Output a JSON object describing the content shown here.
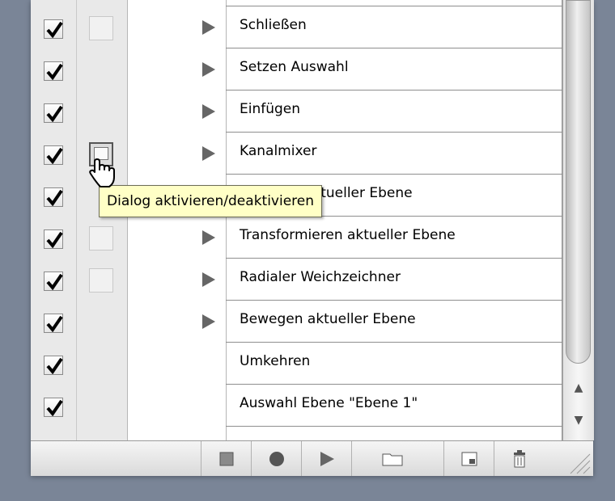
{
  "actions": [
    {
      "label": "Schließen",
      "checked": true,
      "dialog": "empty",
      "expandable": true
    },
    {
      "label": "Setzen Auswahl",
      "checked": true,
      "dialog": "none",
      "expandable": true
    },
    {
      "label": "Einfügen",
      "checked": true,
      "dialog": "none",
      "expandable": true
    },
    {
      "label": "Kanalmixer",
      "checked": true,
      "dialog": "active",
      "expandable": true
    },
    {
      "label": "Kopieren aktueller Ebene",
      "checked": true,
      "dialog": "none",
      "expandable": true
    },
    {
      "label": "Transformieren aktueller Ebene",
      "checked": true,
      "dialog": "empty",
      "expandable": true
    },
    {
      "label": "Radialer Weichzeichner",
      "checked": true,
      "dialog": "empty",
      "expandable": true
    },
    {
      "label": "Bewegen aktueller Ebene",
      "checked": true,
      "dialog": "none",
      "expandable": true
    },
    {
      "label": "Umkehren",
      "checked": true,
      "dialog": "none",
      "expandable": false
    },
    {
      "label": "Auswahl Ebene \"Ebene 1\"",
      "checked": true,
      "dialog": "none",
      "expandable": false
    }
  ],
  "tooltip": {
    "text": "Dialog aktivieren/deaktivieren"
  },
  "toolbar": {
    "buttons": [
      "stop-icon",
      "record-icon",
      "play-icon",
      "new-set-icon",
      "new-action-icon",
      "trash-icon"
    ]
  },
  "scrollbar": {
    "up_arrow": "▲",
    "down_arrow": "▼"
  },
  "colors": {
    "background": "#7a8597",
    "tooltip_bg": "#ffffc6",
    "triangle": "#666666"
  }
}
